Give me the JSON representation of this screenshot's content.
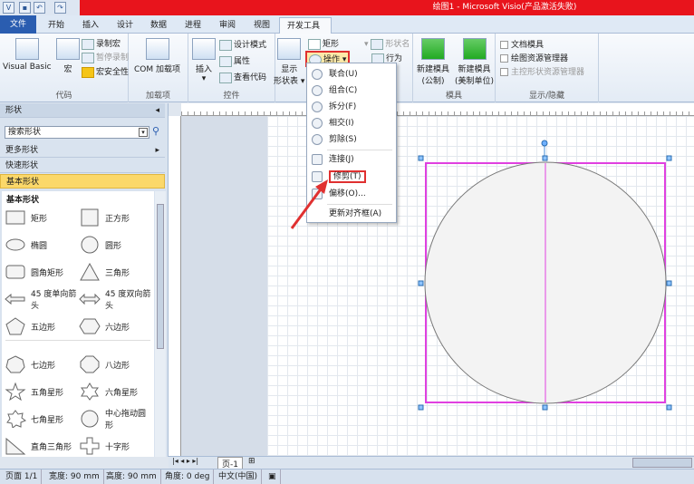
{
  "window": {
    "title": "绘图1 - Microsoft Visio(产品激活失败)"
  },
  "quick_access": [
    "save-icon",
    "undo-icon",
    "redo-icon"
  ],
  "tabs": [
    {
      "label": "文件"
    },
    {
      "label": "开始"
    },
    {
      "label": "插入"
    },
    {
      "label": "设计"
    },
    {
      "label": "数据"
    },
    {
      "label": "进程"
    },
    {
      "label": "审阅"
    },
    {
      "label": "视图"
    },
    {
      "label": "开发工具"
    }
  ],
  "ribbon": {
    "code": {
      "label": "代码",
      "visual_basic": "Visual Basic",
      "macro": "宏",
      "record": "录制宏",
      "pause": "暂停录制",
      "security": "宏安全性"
    },
    "addins": {
      "label": "加载项",
      "com": "COM 加载项"
    },
    "controls": {
      "label": "控件",
      "insert": "插入",
      "design": "设计模式",
      "properties": "属性",
      "view_code": "查看代码"
    },
    "shapesheet": {
      "show": "显示",
      "sheet": "形状表"
    },
    "shape_design": {
      "rect": "矩形",
      "operations": "操作",
      "shape_name": "形状名",
      "behavior": "行为"
    },
    "stencil": {
      "label": "模具",
      "new_metric": "新建模具",
      "metric": "(公制)",
      "new_us": "新建模具",
      "us": "(美制单位)"
    },
    "showhide": {
      "label": "显示/隐藏",
      "doc_stencil": "文档模具",
      "drawing_explorer": "绘图资源管理器",
      "master_explorer": "主控形状资源管理器"
    }
  },
  "menu": {
    "items": [
      {
        "label": "联合(U)"
      },
      {
        "label": "组合(C)"
      },
      {
        "label": "拆分(F)"
      },
      {
        "label": "相交(I)"
      },
      {
        "label": "剪除(S)"
      },
      {
        "label": "连接(J)"
      },
      {
        "label": "修剪(T)",
        "highlighted": true
      },
      {
        "label": "偏移(O)..."
      },
      {
        "label": "更新对齐框(A)"
      }
    ]
  },
  "panel": {
    "title": "形状",
    "search_placeholder": "搜索形状",
    "more": "更多形状",
    "quick": "快速形状",
    "basic": "基本形状",
    "section": "基本形状",
    "shapes": [
      "矩形",
      "正方形",
      "椭圆",
      "圆形",
      "圆角矩形",
      "三角形",
      "45 度单向箭头",
      "45 度双向箭头",
      "五边形",
      "六边形",
      "七边形",
      "八边形",
      "五角星形",
      "六角星形",
      "七角星形",
      "中心拖动圆形",
      "直角三角形",
      "十字形"
    ]
  },
  "page_tab": "页-1",
  "status": {
    "page": "页面 1/1",
    "width": "宽度: 90 mm",
    "height": "高度: 90 mm",
    "angle": "角度: 0 deg",
    "lang": "中文(中国)"
  },
  "colors": {
    "title_bar": "#e8141c",
    "file_tab": "#2a5db0",
    "highlight": "#e03030",
    "selection": "#e040e0",
    "active_stencil": "#fbd86a"
  }
}
